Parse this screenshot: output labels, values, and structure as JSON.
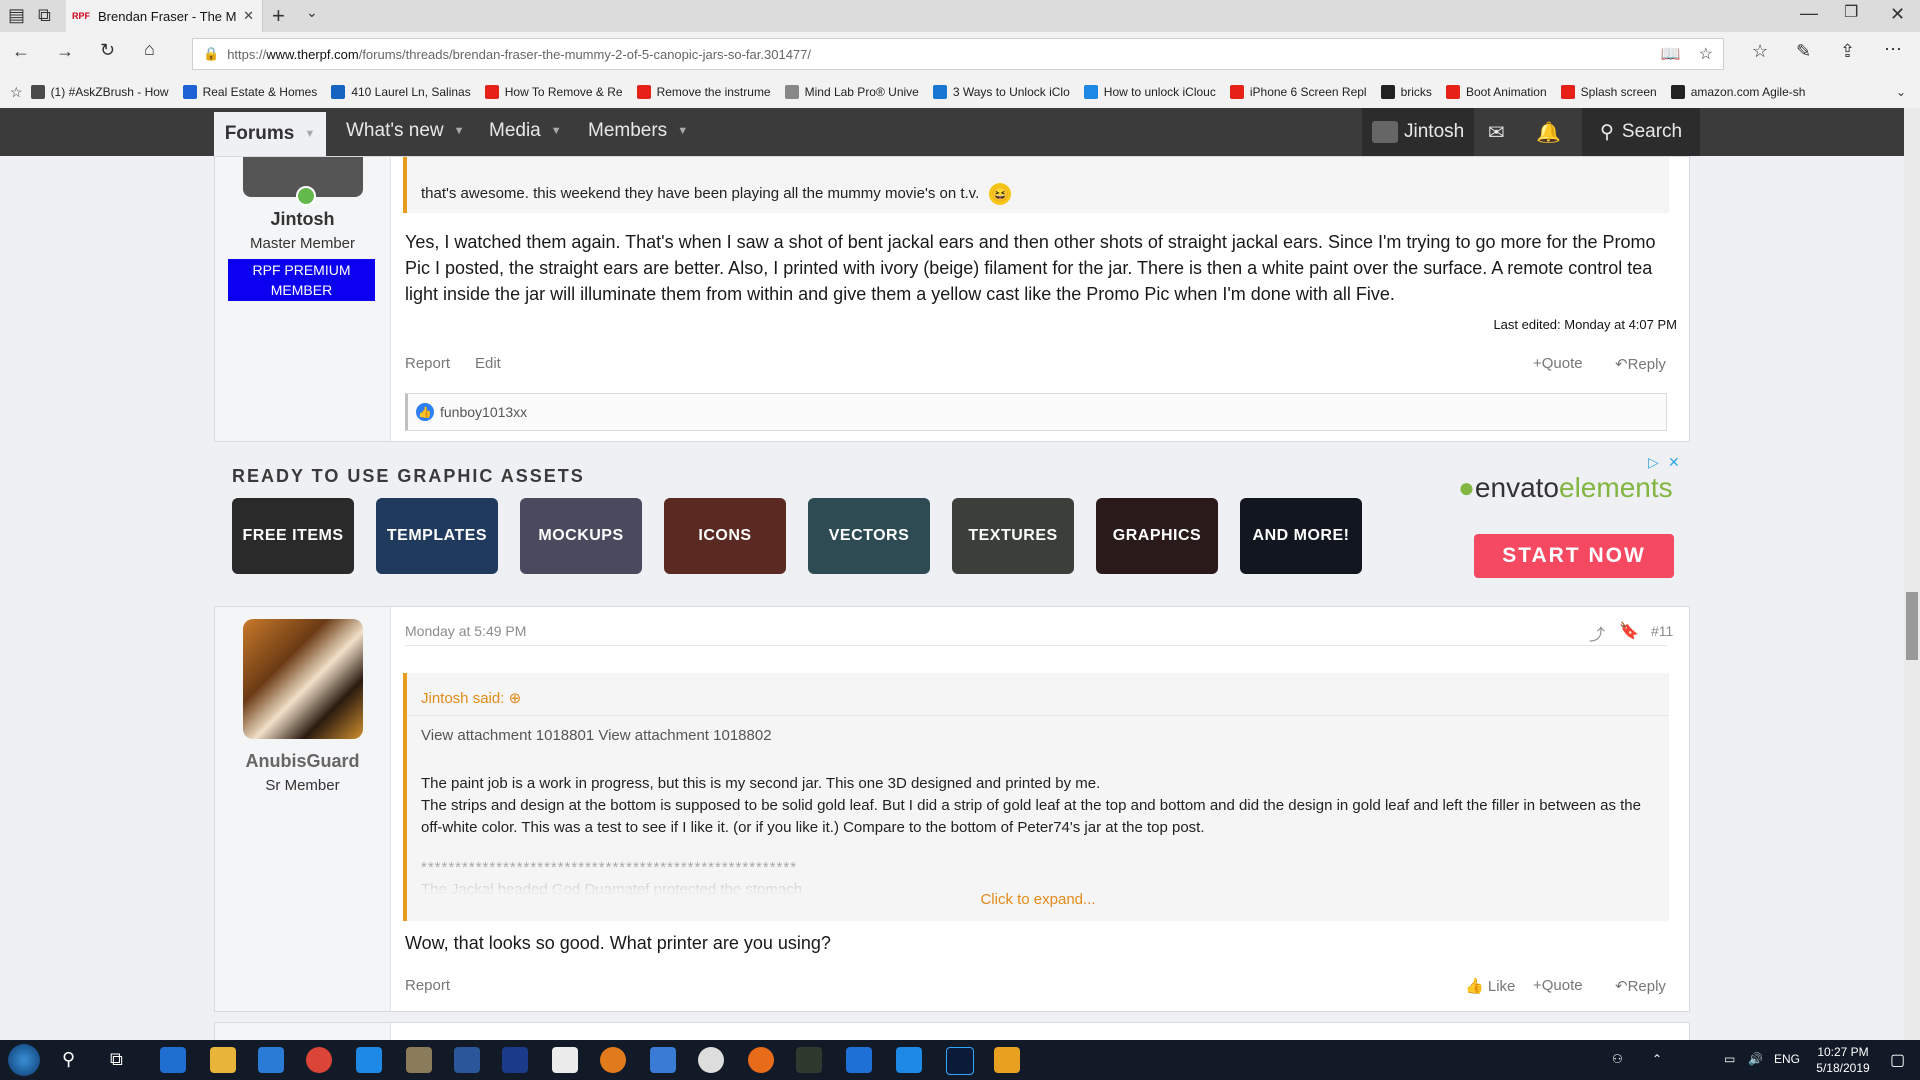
{
  "browser": {
    "tab_title": "Brendan Fraser - The M",
    "url_prefix": "https://",
    "url_host": "www.therpf.com",
    "url_path": "/forums/threads/brendan-fraser-the-mummy-2-of-5-canopic-jars-so-far.301477/",
    "bookmarks": [
      {
        "label": "(1) #AskZBrush - How",
        "color": "#4a4a4a"
      },
      {
        "label": "Real Estate & Homes",
        "color": "#1e63d6"
      },
      {
        "label": "410 Laurel Ln, Salinas",
        "color": "#1565c0"
      },
      {
        "label": "How To Remove & Re",
        "color": "#e62117"
      },
      {
        "label": "Remove the instrume",
        "color": "#e62117"
      },
      {
        "label": "Mind Lab Pro® Unive",
        "color": "#888888"
      },
      {
        "label": "3 Ways to Unlock iClo",
        "color": "#1976d2"
      },
      {
        "label": "How to unlock iClouc",
        "color": "#1e88e5"
      },
      {
        "label": "iPhone 6 Screen Repl",
        "color": "#e62117"
      },
      {
        "label": "bricks",
        "color": "#222222"
      },
      {
        "label": "Boot Animation",
        "color": "#e62117"
      },
      {
        "label": "Splash screen",
        "color": "#e62117"
      },
      {
        "label": "amazon.com Agile-sh",
        "color": "#222222"
      }
    ]
  },
  "nav": {
    "forums": "Forums",
    "whats_new": "What's new",
    "media": "Media",
    "members": "Members",
    "user": "Jintosh",
    "search": "Search"
  },
  "post1": {
    "username": "Jintosh",
    "user_title": "Master Member",
    "banner": "RPF PREMIUM MEMBER",
    "quote_text": "that's awesome. this weekend they have been playing all the mummy movie's on t.v.",
    "body": "Yes, I watched them again. That's when I saw a shot of bent jackal ears and then other shots of straight jackal ears. Since I'm trying to go more for the Promo Pic I posted, the straight ears are better. Also, I printed with ivory (beige) filament for the jar. There is then a white paint over the surface. A remote control tea light inside the jar will illuminate them from within and give them a yellow cast like the Promo Pic when I'm done with all Five.",
    "last_edited": "Last edited: Monday at 4:07 PM",
    "report": "Report",
    "edit": "Edit",
    "quote": "Quote",
    "reply": "Reply",
    "likes": "funboy1013xx"
  },
  "ad": {
    "heading": "READY TO USE GRAPHIC ASSETS",
    "tiles": [
      {
        "label": "FREE ITEMS",
        "color": "#2a2a2a"
      },
      {
        "label": "TEMPLATES",
        "color": "#1f3a5c"
      },
      {
        "label": "MOCKUPS",
        "color": "#4a4a5e"
      },
      {
        "label": "ICONS",
        "color": "#5a2a22"
      },
      {
        "label": "VECTORS",
        "color": "#2e4a52"
      },
      {
        "label": "TEXTURES",
        "color": "#3a3f3a"
      },
      {
        "label": "GRAPHICS",
        "color": "#2a1a1a"
      },
      {
        "label": "AND MORE!",
        "color": "#121620"
      }
    ],
    "brand_a": "envato",
    "brand_b": "elements",
    "cta": "START NOW"
  },
  "post2": {
    "username": "AnubisGuard",
    "user_title": "Sr Member",
    "timestamp": "Monday at 5:49 PM",
    "post_number": "#11",
    "quote_author": "Jintosh said:",
    "quote_attach": "View attachment 1018801 View attachment 1018802",
    "quote_p1": "The paint job is a work in progress, but this is my second jar. This one 3D designed and printed by me.",
    "quote_p2": "The strips and design at the bottom is supposed to be solid gold leaf. But I did a strip of gold leaf at the top and bottom and did the design in gold leaf and left the filler in between as the off-white color. This was a test to see if I like it. (or if you like it.) Compare to the bottom of Peter74's jar at the top post.",
    "quote_stars": "*******************************************************",
    "quote_faded": "The Jackal headed God Duamatef protected the stomach",
    "expand": "Click to expand...",
    "body": "Wow, that looks so good. What printer are you using?",
    "report": "Report",
    "like": "Like",
    "quote": "Quote",
    "reply": "Reply"
  },
  "taskbar": {
    "lang": "ENG",
    "time": "10:27 PM",
    "date": "5/18/2019"
  }
}
